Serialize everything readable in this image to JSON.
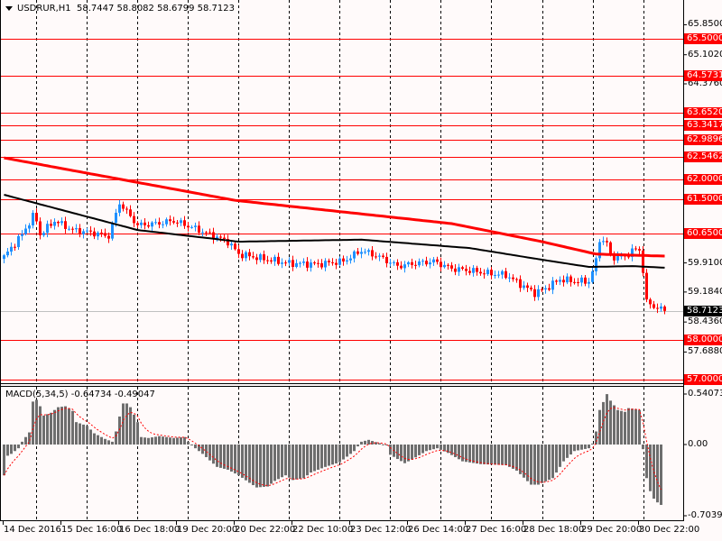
{
  "header": {
    "symbol": "USDRUR,H1",
    "ohlc": "58.7447 58.8082 58.6799 58.7123"
  },
  "macd": {
    "title": "MACD(5,34,5) -0.64734 -0.49047",
    "axis_labels": [
      "0.54073",
      "0.00",
      "-0.70391"
    ],
    "axis_values": [
      0.54073,
      0,
      -0.70391
    ]
  },
  "price_axis": {
    "labels": [
      "65.8500",
      "65.1020",
      "64.3760",
      "59.9100",
      "59.1840",
      "58.4360",
      "57.6880"
    ],
    "values": [
      65.85,
      65.102,
      64.376,
      59.91,
      59.184,
      58.436,
      57.688
    ]
  },
  "levels": {
    "labels": [
      "65.5000",
      "64.5731",
      "63.6520",
      "63.3417",
      "62.9896",
      "62.5462",
      "62.0000",
      "61.5000",
      "60.6500",
      "58.0000",
      "57.0000"
    ],
    "values": [
      65.5,
      64.5731,
      63.652,
      63.3417,
      62.9896,
      62.5462,
      62.0,
      61.5,
      60.65,
      58.0,
      57.0
    ],
    "color": "#ff0000"
  },
  "current_price": {
    "label": "58.7123",
    "value": 58.7123
  },
  "time_axis": [
    "14 Dec 2016",
    "15 Dec 16:00",
    "16 Dec 18:00",
    "19 Dec 20:00",
    "20 Dec 22:00",
    "22 Dec 10:00",
    "23 Dec 12:00",
    "26 Dec 14:00",
    "27 Dec 16:00",
    "28 Dec 18:00",
    "29 Dec 20:00",
    "30 Dec 22:00"
  ],
  "colors": {
    "bull": "#1e90ff",
    "bear": "#ff0000",
    "ma_slow": "#ff0000",
    "ma_fast": "#000000",
    "histogram": "#6e6e6e",
    "signal": "#ff0000",
    "grid": "#000000"
  },
  "chart_data": {
    "type": "candlestick",
    "bars": 184,
    "close_keypoints": [
      [
        0,
        60.06
      ],
      [
        3,
        60.4
      ],
      [
        5,
        60.62
      ],
      [
        8,
        61.07
      ],
      [
        9,
        60.96
      ],
      [
        10,
        60.62
      ],
      [
        14,
        60.96
      ],
      [
        19,
        60.73
      ],
      [
        24,
        60.67
      ],
      [
        29,
        60.58
      ],
      [
        32,
        61.41
      ],
      [
        34,
        61.18
      ],
      [
        37,
        60.85
      ],
      [
        42,
        60.89
      ],
      [
        47,
        60.96
      ],
      [
        52,
        60.8
      ],
      [
        57,
        60.62
      ],
      [
        62,
        60.44
      ],
      [
        65,
        60.13
      ],
      [
        72,
        60.01
      ],
      [
        79,
        59.9
      ],
      [
        87,
        59.88
      ],
      [
        94,
        59.95
      ],
      [
        99,
        60.22
      ],
      [
        104,
        60.06
      ],
      [
        109,
        59.83
      ],
      [
        114,
        59.9
      ],
      [
        119,
        59.95
      ],
      [
        124,
        59.77
      ],
      [
        129,
        59.72
      ],
      [
        134,
        59.65
      ],
      [
        139,
        59.61
      ],
      [
        143,
        59.38
      ],
      [
        147,
        59.16
      ],
      [
        150,
        59.27
      ],
      [
        154,
        59.5
      ],
      [
        158,
        59.45
      ],
      [
        162,
        59.45
      ],
      [
        164,
        59.95
      ],
      [
        165,
        60.51
      ],
      [
        167,
        60.4
      ],
      [
        168,
        60.06
      ],
      [
        172,
        60.06
      ],
      [
        174,
        60.22
      ],
      [
        176,
        60.24
      ],
      [
        177,
        59.72
      ],
      [
        178,
        58.93
      ],
      [
        179,
        58.87
      ],
      [
        183,
        58.7123
      ]
    ],
    "ma_red_keypoints": [
      [
        0,
        62.53
      ],
      [
        32,
        62.0
      ],
      [
        64,
        61.47
      ],
      [
        124,
        60.89
      ],
      [
        149,
        60.44
      ],
      [
        164,
        60.13
      ],
      [
        183,
        60.08
      ]
    ],
    "ma_black_keypoints": [
      [
        0,
        61.61
      ],
      [
        37,
        60.73
      ],
      [
        65,
        60.44
      ],
      [
        99,
        60.49
      ],
      [
        129,
        60.28
      ],
      [
        149,
        59.99
      ],
      [
        162,
        59.81
      ],
      [
        174,
        59.83
      ],
      [
        183,
        59.79
      ]
    ],
    "macd_hist_keypoints": [
      [
        0,
        -0.33
      ],
      [
        1,
        -0.12
      ],
      [
        2,
        -0.1
      ],
      [
        4,
        -0.04
      ],
      [
        5,
        0.03
      ],
      [
        7,
        0.13
      ],
      [
        8,
        0.46
      ],
      [
        9,
        0.48
      ],
      [
        10,
        0.41
      ],
      [
        11,
        0.31
      ],
      [
        13,
        0.34
      ],
      [
        15,
        0.4
      ],
      [
        17,
        0.41
      ],
      [
        19,
        0.36
      ],
      [
        20,
        0.24
      ],
      [
        23,
        0.2
      ],
      [
        25,
        0.12
      ],
      [
        28,
        0.06
      ],
      [
        30,
        0.03
      ],
      [
        31,
        0.14
      ],
      [
        32,
        0.3
      ],
      [
        33,
        0.44
      ],
      [
        34,
        0.44
      ],
      [
        35,
        0.4
      ],
      [
        37,
        0.24
      ],
      [
        38,
        0.08
      ],
      [
        40,
        0.07
      ],
      [
        43,
        0.09
      ],
      [
        47,
        0.07
      ],
      [
        50,
        0.08
      ],
      [
        51,
        0.03
      ],
      [
        53,
        -0.04
      ],
      [
        55,
        -0.1
      ],
      [
        59,
        -0.24
      ],
      [
        62,
        -0.27
      ],
      [
        65,
        -0.33
      ],
      [
        68,
        -0.41
      ],
      [
        70,
        -0.46
      ],
      [
        73,
        -0.45
      ],
      [
        75,
        -0.39
      ],
      [
        78,
        -0.33
      ],
      [
        80,
        -0.38
      ],
      [
        83,
        -0.36
      ],
      [
        85,
        -0.3
      ],
      [
        89,
        -0.24
      ],
      [
        93,
        -0.19
      ],
      [
        97,
        -0.07
      ],
      [
        99,
        0.03
      ],
      [
        101,
        0.05
      ],
      [
        106,
        -0.01
      ],
      [
        107,
        -0.11
      ],
      [
        111,
        -0.2
      ],
      [
        113,
        -0.16
      ],
      [
        117,
        -0.07
      ],
      [
        120,
        -0.04
      ],
      [
        123,
        -0.09
      ],
      [
        127,
        -0.18
      ],
      [
        132,
        -0.21
      ],
      [
        139,
        -0.22
      ],
      [
        142,
        -0.28
      ],
      [
        146,
        -0.43
      ],
      [
        148,
        -0.43
      ],
      [
        152,
        -0.36
      ],
      [
        155,
        -0.18
      ],
      [
        158,
        -0.07
      ],
      [
        162,
        -0.04
      ],
      [
        163,
        0.01
      ],
      [
        164,
        0.14
      ],
      [
        165,
        0.37
      ],
      [
        167,
        0.54
      ],
      [
        168,
        0.47
      ],
      [
        170,
        0.37
      ],
      [
        172,
        0.35
      ],
      [
        173,
        0.39
      ],
      [
        176,
        0.37
      ],
      [
        177,
        -0.05
      ],
      [
        178,
        -0.36
      ],
      [
        179,
        -0.5
      ],
      [
        180,
        -0.58
      ],
      [
        181,
        -0.62
      ],
      [
        182,
        -0.647
      ]
    ],
    "macd_signal_last": -0.49047,
    "ylim": [
      56.9,
      66.0
    ],
    "macd_ylim": [
      -0.75,
      0.6
    ]
  }
}
